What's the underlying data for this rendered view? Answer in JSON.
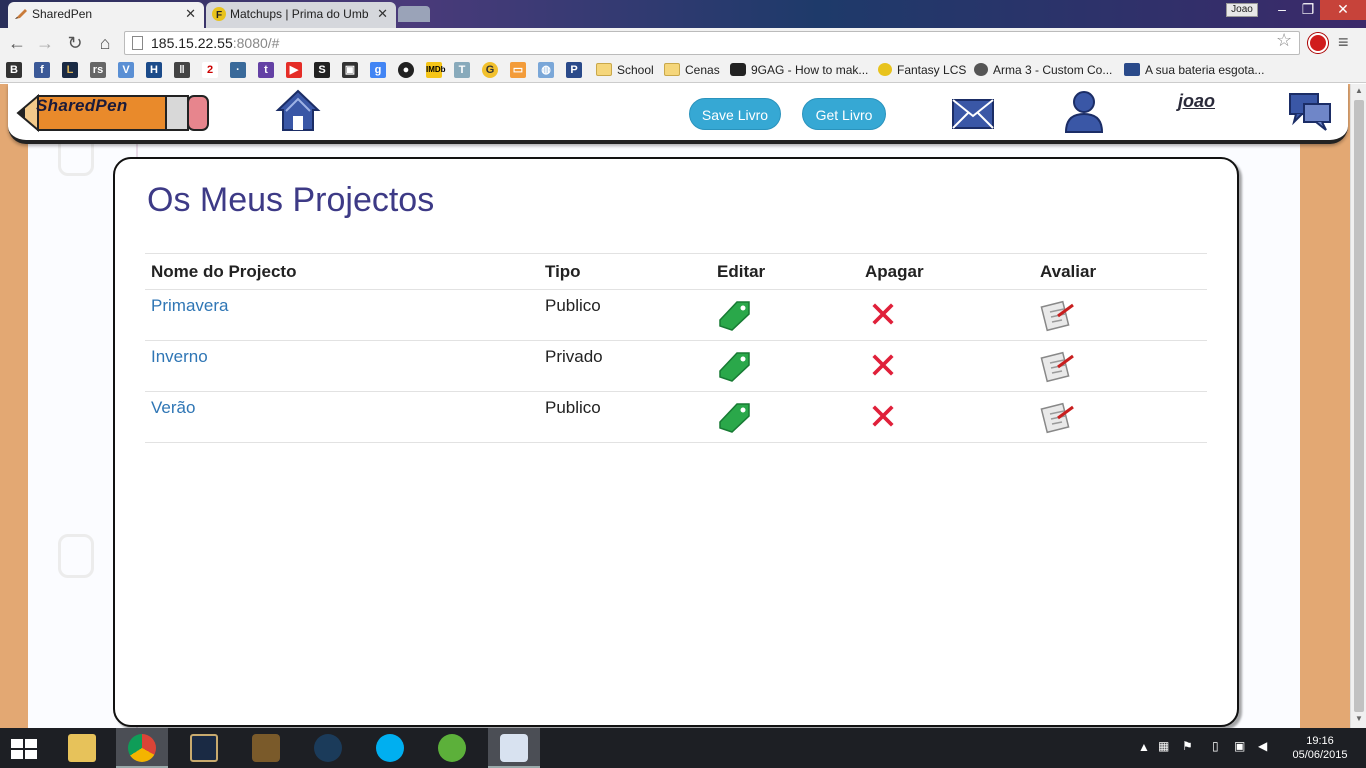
{
  "browser": {
    "tabs": [
      {
        "title": "SharedPen",
        "active": true
      },
      {
        "title": "Matchups | Prima do Umb",
        "active": false
      }
    ],
    "user_chip": "Joao",
    "url_host": "185.15.22.55",
    "url_rest": ":8080/#",
    "bookmarks": [
      {
        "label": "School",
        "type": "folder"
      },
      {
        "label": "Cenas",
        "type": "folder"
      },
      {
        "label": "9GAG - How to mak...",
        "type": "site"
      },
      {
        "label": "Fantasy LCS",
        "type": "site"
      },
      {
        "label": "Arma 3 - Custom Co...",
        "type": "site"
      },
      {
        "label": "A sua bateria esgota...",
        "type": "site"
      }
    ]
  },
  "header": {
    "logo_text": "SharedPen",
    "save_label": "Save Livro",
    "get_label": "Get Livro",
    "username": "joao"
  },
  "main": {
    "title": "Os Meus Projectos",
    "columns": [
      "Nome do Projecto",
      "Tipo",
      "Editar",
      "Apagar",
      "Avaliar"
    ],
    "rows": [
      {
        "name": "Primavera",
        "tipo": "Publico"
      },
      {
        "name": "Inverno",
        "tipo": "Privado"
      },
      {
        "name": "Verão",
        "tipo": "Publico"
      }
    ]
  },
  "taskbar": {
    "time": "19:16",
    "date": "05/06/2015"
  },
  "colors": {
    "accent_button": "#36a8d4",
    "title": "#3d3a86",
    "link": "#2f76b5",
    "edit_icon": "#2aa84a",
    "delete_icon": "#e0203a",
    "page_border": "#e3a873"
  }
}
